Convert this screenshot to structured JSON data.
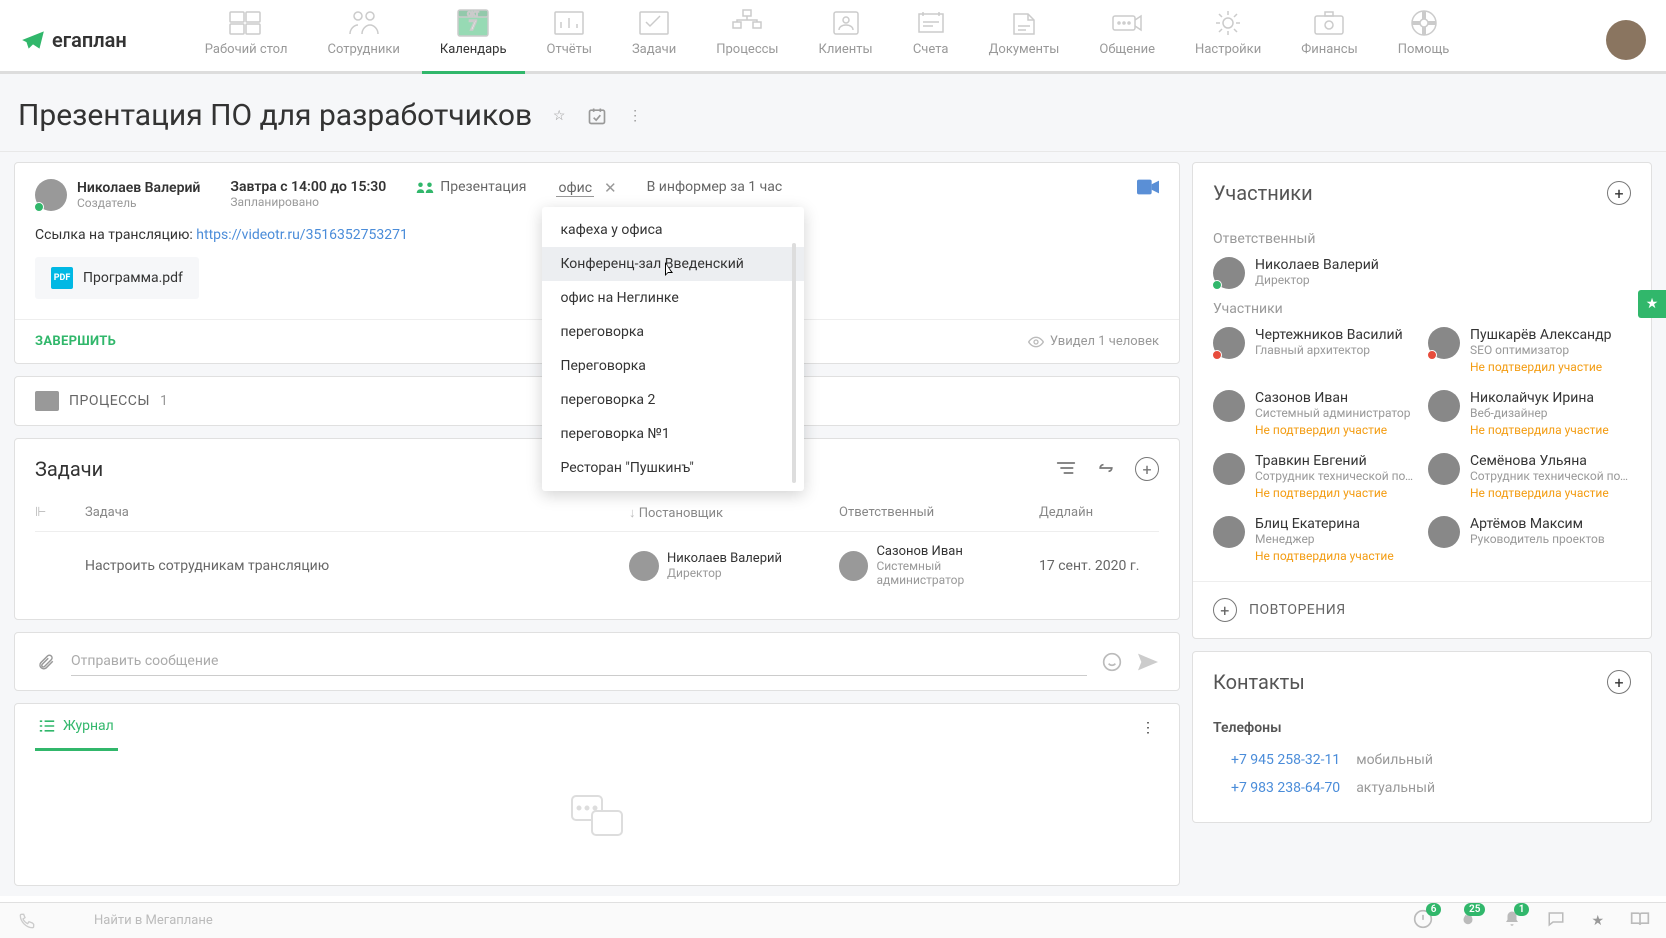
{
  "logo": "егаплан",
  "nav": [
    {
      "label": "Рабочий стол"
    },
    {
      "label": "Сотрудники"
    },
    {
      "label": "Календарь",
      "active": true
    },
    {
      "label": "Отчёты"
    },
    {
      "label": "Задачи"
    },
    {
      "label": "Процессы"
    },
    {
      "label": "Клиенты"
    },
    {
      "label": "Счета"
    },
    {
      "label": "Документы"
    },
    {
      "label": "Общение"
    },
    {
      "label": "Настройки"
    },
    {
      "label": "Финансы"
    },
    {
      "label": "Помощь"
    }
  ],
  "page_title": "Презентация ПО для разработчиков",
  "event": {
    "creator": {
      "name": "Николаев Валерий",
      "role": "Создатель"
    },
    "time": "Завтра с 14:00 до 15:30",
    "status": "Запланировано",
    "type": "Презентация",
    "location": "офис",
    "reminder": "В информер за 1 час",
    "link_label": "Ссылка на трансляцию:",
    "link_url": "https://videotr.ru/3516352753271",
    "file": "Программа.pdf",
    "file_badge": "PDF",
    "complete": "ЗАВЕРШИТЬ",
    "views": "Увидел 1 человек"
  },
  "location_options": [
    "кафеха у офиса",
    "Конференц-зал Введенский",
    "офис на Неглинке",
    "переговорка",
    "Переговорка",
    "переговорка 2",
    "переговорка №1",
    "Ресторан \"Пушкинъ\""
  ],
  "process": {
    "label": "ПРОЦЕССЫ",
    "count": "1"
  },
  "tasks": {
    "title": "Задачи",
    "headers": {
      "task": "Задача",
      "assigner": "Постановщик",
      "responsible": "Ответственный",
      "deadline": "Дедлайн"
    },
    "rows": [
      {
        "task": "Настроить сотрудникам трансляцию",
        "assigner": {
          "name": "Николаев Валерий",
          "role": "Директор"
        },
        "responsible": {
          "name": "Сазонов Иван",
          "role": "Системный администратор"
        },
        "deadline": "17 сент. 2020 г."
      }
    ]
  },
  "message_placeholder": "Отправить сообщение",
  "journal_label": "Журнал",
  "participants": {
    "title": "Участники",
    "responsible_label": "Ответственный",
    "responsible": {
      "name": "Николаев Валерий",
      "role": "Директор"
    },
    "members_label": "Участники",
    "members": [
      {
        "name": "Чертежников Василий",
        "role": "Главный архитектор"
      },
      {
        "name": "Пушкарёв Александр",
        "role": "SEO оптимизатор",
        "warn": "Не подтвердил участие"
      },
      {
        "name": "Сазонов Иван",
        "role": "Системный администратор",
        "warn": "Не подтвердил участие"
      },
      {
        "name": "Николайчук Ирина",
        "role": "Веб-дизайнер",
        "warn": "Не подтвердила участие"
      },
      {
        "name": "Травкин Евгений",
        "role": "Сотрудник технической поддерж...",
        "warn": "Не подтвердил участие"
      },
      {
        "name": "Семёнова Ульяна",
        "role": "Сотрудник технической поддерж...",
        "warn": "Не подтвердила участие"
      },
      {
        "name": "Блиц Екатерина",
        "role": "Менеджер",
        "warn": "Не подтвердила участие"
      },
      {
        "name": "Артёмов Максим",
        "role": "Руководитель проектов"
      }
    ]
  },
  "repeat": "ПОВТОРЕНИЯ",
  "contacts": {
    "title": "Контакты",
    "phones_label": "Телефоны",
    "phones": [
      {
        "num": "+7 945 258-32-11",
        "lbl": "мобильный"
      },
      {
        "num": "+7 983 238-64-70",
        "lbl": "актуальный"
      }
    ]
  },
  "bottom": {
    "search": "Найти в Мегаплане"
  },
  "tray_badges": {
    "alert": "6",
    "fire": "25",
    "bell": "1"
  }
}
